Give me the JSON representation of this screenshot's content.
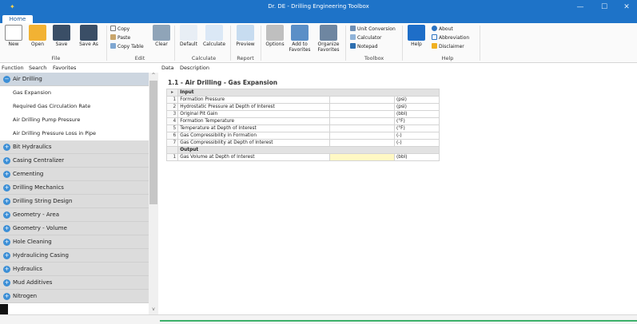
{
  "window": {
    "title": "Dr. DE - Drilling Engineering Toolbox",
    "minimize": "—",
    "maximize": "☐",
    "close": "✕"
  },
  "ribbon_tabs": [
    "Home"
  ],
  "ribbon": {
    "file": {
      "label": "File",
      "buttons": [
        "New",
        "Open",
        "Save",
        "Save As"
      ]
    },
    "edit": {
      "label": "Edit",
      "small": [
        "Copy",
        "Paste",
        "Copy Table"
      ],
      "clear": "Clear"
    },
    "calculate": {
      "label": "Calculate",
      "buttons": [
        "Default",
        "Calculate"
      ]
    },
    "report": {
      "label": "Report",
      "buttons": [
        "Preview"
      ]
    },
    "favorites": {
      "buttons": [
        "Options",
        "Add to Favorites",
        "Organize Favorites"
      ]
    },
    "toolbox": {
      "label": "Toolbox",
      "small": [
        "Unit Conversion",
        "Calculator",
        "Notepad"
      ]
    },
    "help": {
      "label": "Help",
      "button": "Help",
      "small": [
        "About",
        "Abbreviation",
        "Disclaimer"
      ]
    }
  },
  "panel_tabs": [
    "Function",
    "Search",
    "Favorites"
  ],
  "data_tabs": [
    "Data",
    "Description"
  ],
  "sidebar": {
    "open_category": "Air Drilling",
    "open_items": [
      "Gas Expansion",
      "Required Gas Circulation Rate",
      "Air Drilling Pump Pressure",
      "Air Drilling Pressure Loss in Pipe"
    ],
    "categories": [
      "Bit Hydraulics",
      "Casing Centralizer",
      "Cementing",
      "Drilling Mechanics",
      "Drilling String Design",
      "Geometry - Area",
      "Geometry - Volume",
      "Hole Cleaning",
      "Hydraulicing Casing",
      "Hydraulics",
      "Mud Additives",
      "Nitrogen"
    ]
  },
  "main": {
    "section_title": "1.1 - Air Drilling - Gas Expansion",
    "input_header": "Input",
    "output_header": "Output",
    "inputs": [
      {
        "n": "1",
        "name": "Formation Pressure",
        "unit": "(psi)"
      },
      {
        "n": "2",
        "name": "Hydrostatic Pressure at Depth of Interest",
        "unit": "(psi)"
      },
      {
        "n": "3",
        "name": "Original Pit Gain",
        "unit": "(bbl)"
      },
      {
        "n": "4",
        "name": "Formation Temperature",
        "unit": "(°F)"
      },
      {
        "n": "5",
        "name": "Temperature at Depth of Interest",
        "unit": "(°F)"
      },
      {
        "n": "6",
        "name": "Gas Compressibility in Formation",
        "unit": "(-)"
      },
      {
        "n": "7",
        "name": "Gas Compressibility at Depth of Interest",
        "unit": "(-)"
      }
    ],
    "outputs": [
      {
        "n": "1",
        "name": "Gas Volume at Depth of Interest",
        "unit": "(bbl)"
      }
    ]
  }
}
